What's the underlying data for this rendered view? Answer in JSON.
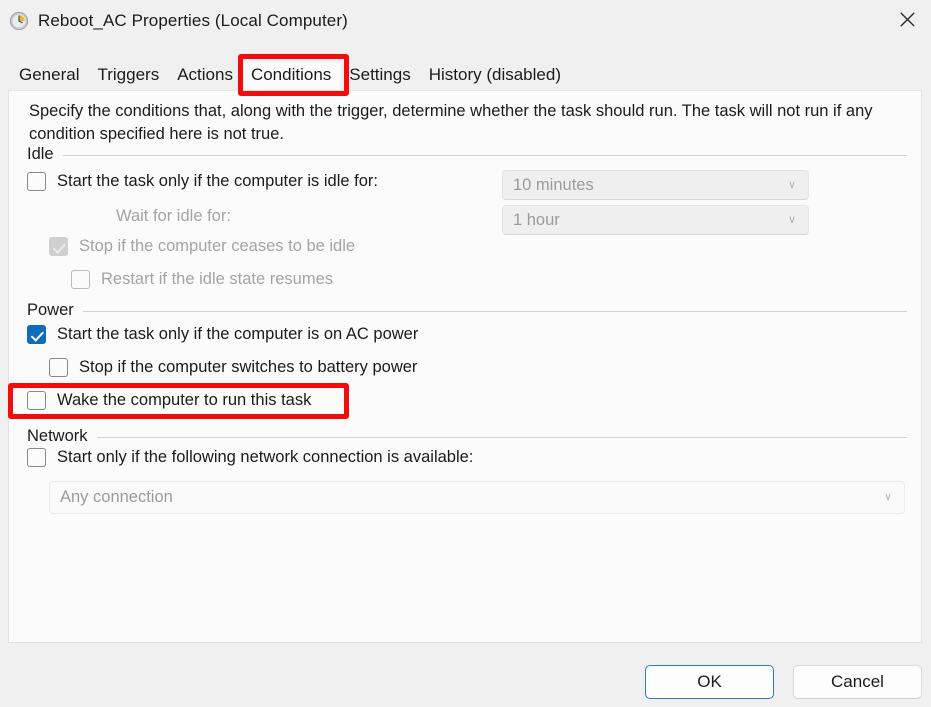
{
  "window": {
    "title": "Reboot_AC Properties (Local Computer)",
    "icon": "task-scheduler-clock-icon",
    "close_label": "✕"
  },
  "tabs": [
    {
      "label": "General",
      "selected": false
    },
    {
      "label": "Triggers",
      "selected": false
    },
    {
      "label": "Actions",
      "selected": false
    },
    {
      "label": "Conditions",
      "selected": true
    },
    {
      "label": "Settings",
      "selected": false
    },
    {
      "label": "History (disabled)",
      "selected": false
    }
  ],
  "panel": {
    "intro": "Specify the conditions that, along with the trigger, determine whether the task should run.  The task will not run  if any condition specified here is not true.",
    "groups": {
      "idle": "Idle",
      "power": "Power",
      "network": "Network"
    },
    "idle": {
      "start_if_idle_label": "Start the task only if the computer is idle for:",
      "start_if_idle_checked": false,
      "idle_duration_value": "10 minutes",
      "wait_for_idle_label": "Wait for idle for:",
      "wait_for_idle_value": "1 hour",
      "stop_if_ceases_label": "Stop if the computer ceases to be idle",
      "stop_if_ceases_checked": true,
      "stop_if_ceases_disabled": true,
      "restart_if_resumes_label": "Restart if the idle state resumes",
      "restart_if_resumes_checked": false,
      "restart_if_resumes_disabled": true
    },
    "power": {
      "ac_power_label": "Start the task only if the computer is on AC power",
      "ac_power_checked": true,
      "stop_on_battery_label": "Stop if the computer switches to battery power",
      "stop_on_battery_checked": false,
      "wake_computer_label": "Wake the computer to run this task",
      "wake_computer_checked": false
    },
    "network": {
      "start_if_network_label": "Start only if the following network connection is available:",
      "start_if_network_checked": false,
      "connection_value": "Any connection"
    },
    "dropdown_arrow": "∨"
  },
  "footer": {
    "ok_label": "OK",
    "cancel_label": "Cancel"
  },
  "annotations": {
    "color": "#f50b0b",
    "items": [
      {
        "name": "conditions-tab-highlight"
      },
      {
        "name": "wake-computer-highlight"
      }
    ]
  }
}
